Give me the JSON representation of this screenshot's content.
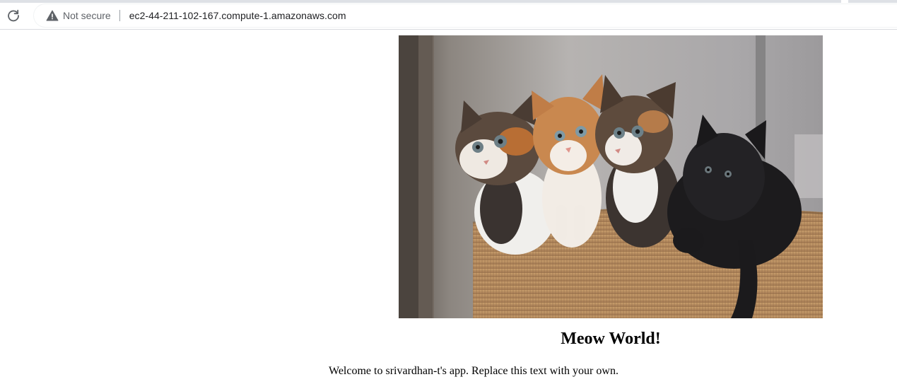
{
  "browser": {
    "security_label": "Not secure",
    "url": "ec2-44-211-102-167.compute-1.amazonaws.com",
    "reload_icon": "reload-icon",
    "security_icon": "warning-triangle-icon"
  },
  "page": {
    "image_alt": "",
    "heading": "Meow World!",
    "welcome_text": "Welcome to srivardhan-t's app. Replace this text with your own."
  },
  "colors": {
    "chrome_border": "#dadce0",
    "text_secondary": "#5f6368",
    "text_primary": "#202124"
  }
}
